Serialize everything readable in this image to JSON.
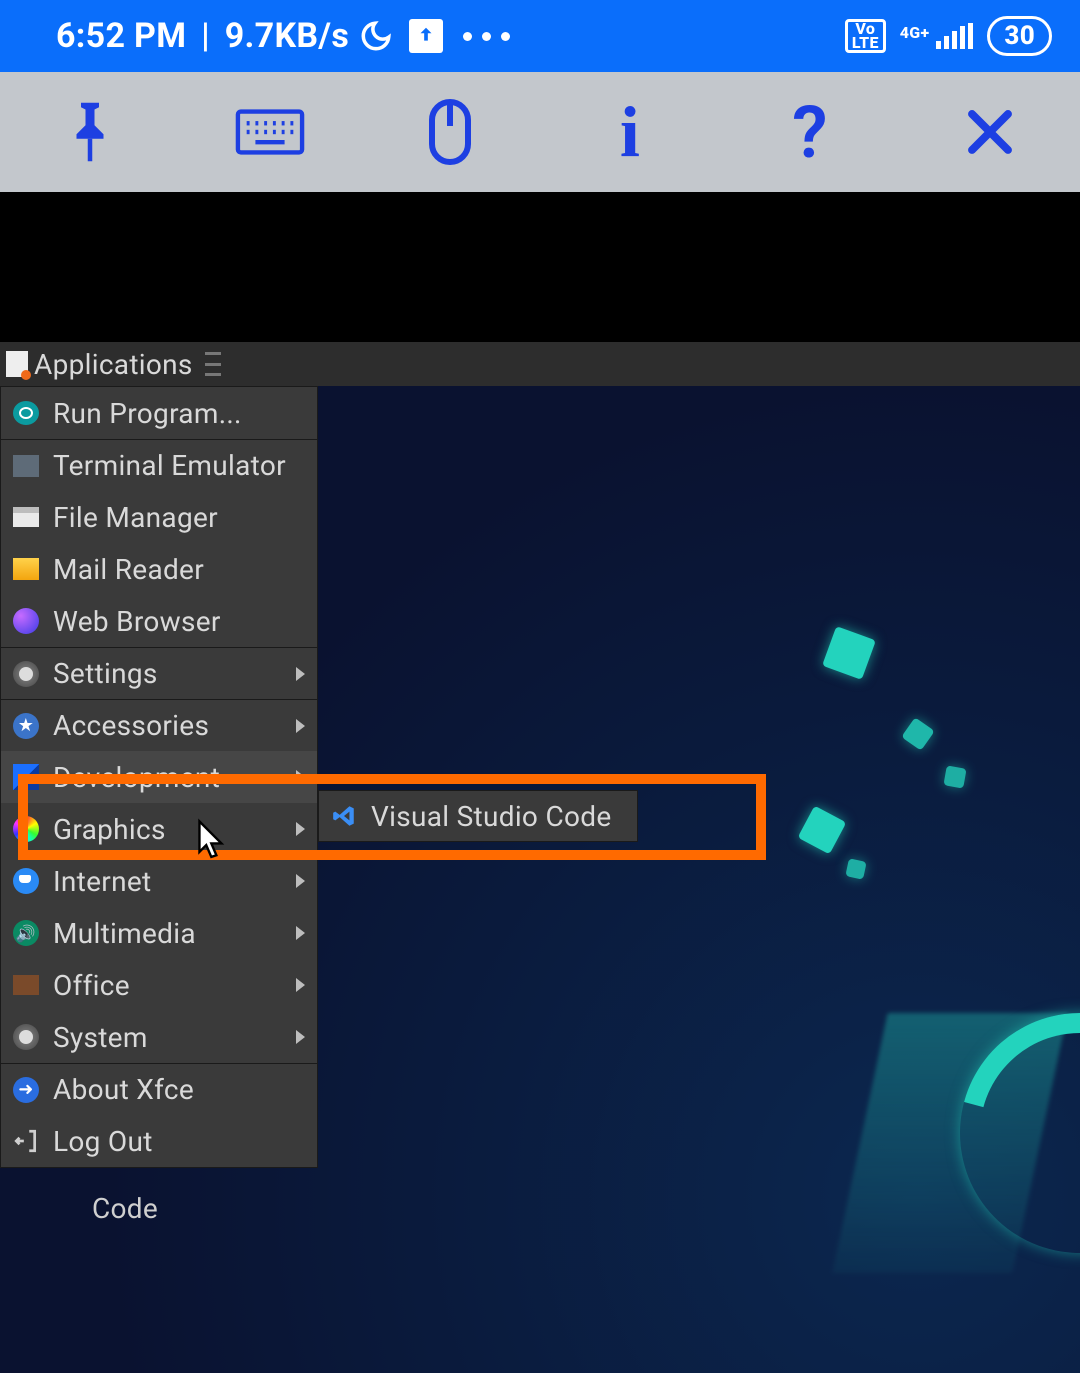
{
  "status_bar": {
    "time": "6:52 PM",
    "net_speed": "9.7KB/s",
    "volte_label": "Vo\nLTE",
    "signal_label": "4G+",
    "battery_percent": "30"
  },
  "vnc_toolbar": {
    "pin_icon": "pin",
    "keyboard_icon": "keyboard",
    "mouse_icon": "mouse",
    "info_icon": "i",
    "help_icon": "?",
    "close_icon": "x"
  },
  "xfce_panel": {
    "applications_label": "Applications"
  },
  "menu": {
    "run_program": "Run Program...",
    "terminal": "Terminal Emulator",
    "file_manager": "File Manager",
    "mail_reader": "Mail Reader",
    "web_browser": "Web Browser",
    "settings": "Settings",
    "accessories": "Accessories",
    "development": "Development",
    "graphics": "Graphics",
    "internet": "Internet",
    "multimedia": "Multimedia",
    "office": "Office",
    "system": "System",
    "about_xfce": "About Xfce",
    "log_out": "Log Out"
  },
  "submenu": {
    "development_items": {
      "vscode": "Visual Studio Code"
    }
  },
  "stray": {
    "code_label": "Code"
  },
  "colors": {
    "status_bar_bg": "#0a6efb",
    "vnc_toolbar_bg": "#c3c7cc",
    "vnc_icon_color": "#1d3fe2",
    "menu_bg": "#3a3a3a",
    "highlight": "#ff6a00",
    "accent_teal": "#23d3bd"
  }
}
